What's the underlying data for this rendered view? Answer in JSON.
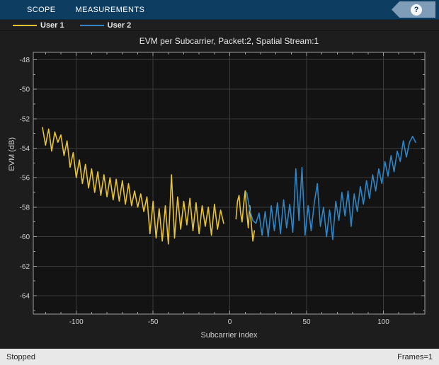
{
  "toolstrip": {
    "tabs": [
      {
        "label": "SCOPE"
      },
      {
        "label": "MEASUREMENTS"
      }
    ],
    "help_icon_glyph": "?"
  },
  "legend": {
    "items": [
      {
        "label": "User 1",
        "color": "#e6c235"
      },
      {
        "label": "User 2",
        "color": "#2e86c8"
      }
    ]
  },
  "status_bar": {
    "left": "Stopped",
    "right": "Frames=1"
  },
  "chart_data": {
    "type": "line",
    "title": "EVM per Subcarrier, Packet:2, Spatial Stream:1",
    "xlabel": "Subcarrier index",
    "ylabel": "EVM (dB)",
    "xlim": [
      -128,
      127
    ],
    "ylim": [
      -65.25,
      -47.5
    ],
    "x_major_ticks": [
      -100,
      -50,
      0,
      50,
      100
    ],
    "y_major_ticks": [
      -48,
      -50,
      -52,
      -54,
      -56,
      -58,
      -60,
      -62,
      -64
    ],
    "x_minor_step": 10,
    "y_minor_step": 1,
    "grid": true,
    "grid_color": "#3a3a3a",
    "axes_background": "#131313",
    "axes_border_color": "#9e9e9e",
    "tick_label_color": "#cfcfcf",
    "legend_position": "top-bar",
    "series": [
      {
        "name": "User 1",
        "color": "#e6c235",
        "segments": [
          [
            [
              -122,
              -52.6
            ],
            [
              -120,
              -53.8
            ],
            [
              -118,
              -52.7
            ],
            [
              -116,
              -54.2
            ],
            [
              -114,
              -52.9
            ],
            [
              -112,
              -53.6
            ],
            [
              -110,
              -53.1
            ],
            [
              -108,
              -54.5
            ],
            [
              -106,
              -53.5
            ],
            [
              -104,
              -55.3
            ],
            [
              -102,
              -54.3
            ],
            [
              -100,
              -56.0
            ],
            [
              -98,
              -54.8
            ],
            [
              -96,
              -56.4
            ],
            [
              -94,
              -55.1
            ],
            [
              -92,
              -56.7
            ],
            [
              -90,
              -55.4
            ],
            [
              -88,
              -57.0
            ],
            [
              -86,
              -55.6
            ],
            [
              -84,
              -57.2
            ],
            [
              -82,
              -55.8
            ],
            [
              -80,
              -57.3
            ],
            [
              -78,
              -56.0
            ],
            [
              -76,
              -57.5
            ],
            [
              -74,
              -56.1
            ],
            [
              -72,
              -57.6
            ],
            [
              -70,
              -56.2
            ],
            [
              -68,
              -57.8
            ],
            [
              -66,
              -56.4
            ],
            [
              -64,
              -57.9
            ],
            [
              -62,
              -56.9
            ],
            [
              -60,
              -58.0
            ],
            [
              -58,
              -57.1
            ],
            [
              -56,
              -58.3
            ],
            [
              -54,
              -57.3
            ],
            [
              -52,
              -59.8
            ],
            [
              -50,
              -57.6
            ],
            [
              -48,
              -60.1
            ],
            [
              -46,
              -58.1
            ],
            [
              -44,
              -60.3
            ],
            [
              -42,
              -57.9
            ],
            [
              -40,
              -60.5
            ],
            [
              -38,
              -55.8
            ],
            [
              -36,
              -60.1
            ],
            [
              -34,
              -57.3
            ],
            [
              -32,
              -59.5
            ],
            [
              -30,
              -57.6
            ],
            [
              -28,
              -59.2
            ],
            [
              -26,
              -57.4
            ],
            [
              -24,
              -59.6
            ],
            [
              -22,
              -57.7
            ],
            [
              -20,
              -59.8
            ],
            [
              -18,
              -57.9
            ],
            [
              -16,
              -59.3
            ],
            [
              -14,
              -58.0
            ],
            [
              -12,
              -59.9
            ],
            [
              -10,
              -57.8
            ],
            [
              -8,
              -59.5
            ],
            [
              -6,
              -58.2
            ],
            [
              -4,
              -59.1
            ]
          ],
          [
            [
              4,
              -58.8
            ],
            [
              5,
              -57.6
            ],
            [
              6,
              -57.2
            ],
            [
              7,
              -58.4
            ],
            [
              8,
              -59.0
            ],
            [
              9,
              -57.8
            ],
            [
              10,
              -56.9
            ],
            [
              11,
              -58.3
            ],
            [
              12,
              -59.4
            ],
            [
              13,
              -57.9
            ],
            [
              14,
              -59.1
            ],
            [
              15,
              -60.3
            ],
            [
              16,
              -59.6
            ]
          ]
        ]
      },
      {
        "name": "User 2",
        "color": "#2e86c8",
        "segments": [
          [
            [
              11,
              -57.0
            ],
            [
              13,
              -58.2
            ],
            [
              15,
              -58.9
            ],
            [
              17,
              -59.1
            ],
            [
              19,
              -58.4
            ],
            [
              21,
              -59.9
            ],
            [
              23,
              -58.3
            ],
            [
              25,
              -60.0
            ],
            [
              27,
              -57.9
            ],
            [
              29,
              -59.6
            ],
            [
              31,
              -57.7
            ],
            [
              33,
              -59.8
            ],
            [
              35,
              -57.5
            ],
            [
              37,
              -59.4
            ],
            [
              39,
              -57.8
            ],
            [
              41,
              -59.7
            ],
            [
              43,
              -55.4
            ],
            [
              45,
              -58.9
            ],
            [
              47,
              -55.3
            ],
            [
              49,
              -59.9
            ],
            [
              51,
              -57.9
            ],
            [
              53,
              -59.6
            ],
            [
              55,
              -57.7
            ],
            [
              57,
              -56.4
            ],
            [
              59,
              -59.3
            ],
            [
              61,
              -58.0
            ],
            [
              63,
              -60.0
            ],
            [
              65,
              -58.2
            ],
            [
              67,
              -60.2
            ],
            [
              69,
              -57.6
            ],
            [
              71,
              -58.9
            ],
            [
              73,
              -57.0
            ],
            [
              75,
              -58.6
            ],
            [
              77,
              -56.9
            ],
            [
              79,
              -59.3
            ],
            [
              81,
              -57.1
            ],
            [
              83,
              -58.3
            ],
            [
              85,
              -56.6
            ],
            [
              87,
              -57.8
            ],
            [
              89,
              -56.2
            ],
            [
              91,
              -57.4
            ],
            [
              93,
              -55.8
            ],
            [
              95,
              -56.9
            ],
            [
              97,
              -55.4
            ],
            [
              99,
              -56.4
            ],
            [
              101,
              -54.9
            ],
            [
              103,
              -55.9
            ],
            [
              105,
              -54.5
            ],
            [
              107,
              -55.6
            ],
            [
              109,
              -54.2
            ],
            [
              111,
              -54.9
            ],
            [
              113,
              -53.5
            ],
            [
              115,
              -54.6
            ],
            [
              117,
              -53.6
            ],
            [
              119,
              -53.2
            ],
            [
              121,
              -53.6
            ]
          ]
        ]
      }
    ]
  }
}
